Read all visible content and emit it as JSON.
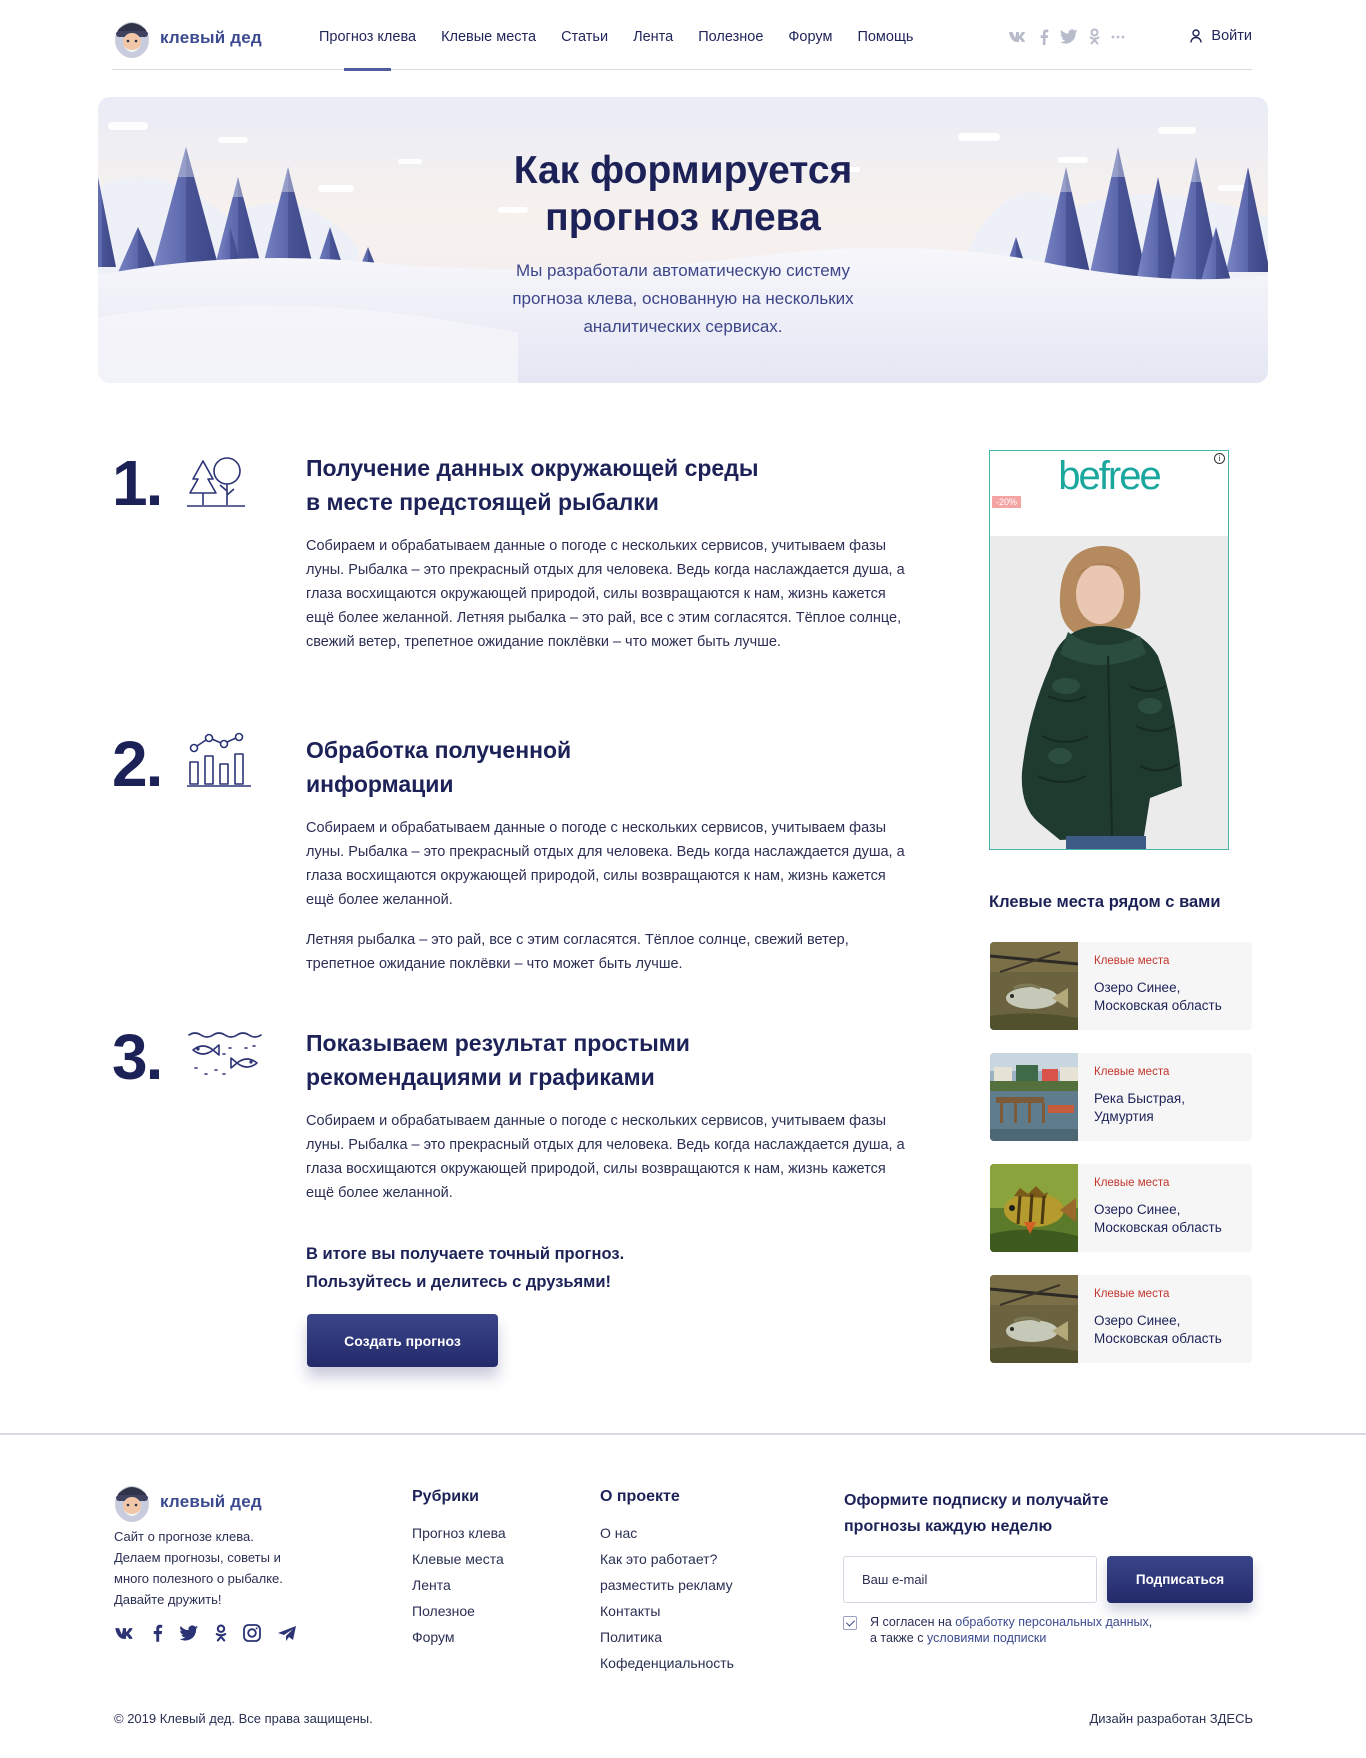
{
  "header": {
    "logo_text": "клевый дед",
    "nav": [
      "Прогноз клева",
      "Клевые места",
      "Статьи",
      "Лента",
      "Полезное",
      "Форум",
      "Помощь"
    ],
    "active_nav_index": 0,
    "social_icons": [
      "vk-icon",
      "facebook-icon",
      "twitter-icon",
      "odnoklassniki-icon",
      "more-icon"
    ],
    "login": "Войти"
  },
  "hero": {
    "title_line1": "Как формируется",
    "title_line2": "прогноз клева",
    "subtitle_line1": "Мы разработали автоматическую систему",
    "subtitle_line2": "прогноза клева, основанную на нескольких",
    "subtitle_line3": "аналитических сервисах."
  },
  "steps": [
    {
      "number": "1.",
      "icon": "trees-icon",
      "title_line1": "Получение данных окружающей среды",
      "title_line2": "в месте предстоящей рыбалки",
      "paragraphs": [
        "Собираем и обрабатываем данные о погоде с нескольких сервисов, учитываем фазы луны. Рыбалка – это прекрасный отдых для человека. Ведь когда наслаждается душа, а глаза восхищаются окружающей природой, силы возвращаются к нам, жизнь кажется ещё более желанной. Летняя рыбалка – это рай, все с этим согласятся. Тёплое солнце, свежий ветер, трепетное ожидание поклёвки – что может быть лучше."
      ]
    },
    {
      "number": "2.",
      "icon": "bar-chart-icon",
      "title_line1": "Обработка полученной",
      "title_line2": "информации",
      "paragraphs": [
        "Собираем и обрабатываем данные о погоде с нескольких сервисов, учитываем фазы луны. Рыбалка – это прекрасный отдых для человека. Ведь когда наслаждается душа, а глаза восхищаются окружающей природой, силы возвращаются к нам, жизнь кажется ещё более желанной.",
        "Летняя рыбалка – это рай, все с этим согласятся. Тёплое солнце, свежий ветер, трепетное ожидание поклёвки – что может быть лучше."
      ]
    },
    {
      "number": "3.",
      "icon": "fish-icon",
      "title_line1": "Показываем результат простыми",
      "title_line2": "рекомендациями и графиками",
      "paragraphs": [
        "Собираем и обрабатываем данные о погоде с нескольких сервисов, учитываем фазы луны. Рыбалка – это прекрасный отдых для человека. Ведь когда наслаждается душа, а глаза восхищаются окружающей природой, силы возвращаются к нам, жизнь кажется ещё более желанной."
      ]
    }
  ],
  "result": {
    "line1": "В итоге вы получаете точный прогноз.",
    "line2": "Пользуйтесь и делитесь с друзьями!",
    "button": "Создать прогноз"
  },
  "ad": {
    "brand": "befree",
    "badge": "-20%",
    "info": "i",
    "accent": "#1aa79e"
  },
  "nearby": {
    "title": "Клевые места рядом с вами",
    "places": [
      {
        "category": "Клевые места",
        "name": "Озеро Синее, Московская область",
        "thumb": "perch-on-grass"
      },
      {
        "category": "Клевые места",
        "name": "Река Быстрая, Удмуртия",
        "thumb": "river-village"
      },
      {
        "category": "Клевые места",
        "name": "Озеро Синее, Московская область",
        "thumb": "perch-underwater"
      },
      {
        "category": "Клевые места",
        "name": "Озеро Синее, Московская область",
        "thumb": "perch-on-grass"
      }
    ]
  },
  "footer": {
    "logo_text": "клевый дед",
    "about_line1": "Сайт о прогнозе клева.",
    "about_line2": "Делаем прогнозы, советы и",
    "about_line3": "много полезного о рыбалке.",
    "about_line4": "Давайте дружить!",
    "social_icons": [
      "vk-icon",
      "facebook-icon",
      "twitter-icon",
      "odnoklassniki-icon",
      "instagram-icon",
      "telegram-icon"
    ],
    "col1": {
      "title": "Рубрики",
      "links": [
        "Прогноз клева",
        "Клевые места",
        "Лента",
        "Полезное",
        "Форум"
      ]
    },
    "col2": {
      "title": "О проекте",
      "links": [
        "О нас",
        "Как это работает?",
        "разместить рекламу",
        "Контакты",
        "Политика",
        "Кофеденциальность"
      ]
    },
    "subscribe_title_line1": "Оформите подписку и получайте",
    "subscribe_title_line2": "прогнозы каждую неделю",
    "email_placeholder": "Ваш e-mail",
    "subscribe_button": "Подписаться",
    "consent_pre": "Я согласен на ",
    "consent_link1": "обработку персональных данных",
    "consent_mid": ", а также с ",
    "consent_link2": "условиями подписки",
    "copyright": "© 2019 Клевый дед. Все права защищены.",
    "design": "Дизайн разработан ЗДЕСЬ"
  },
  "colors": {
    "primary": "#1c2257",
    "button": "#2b3375",
    "accent_red": "#c3362d"
  }
}
